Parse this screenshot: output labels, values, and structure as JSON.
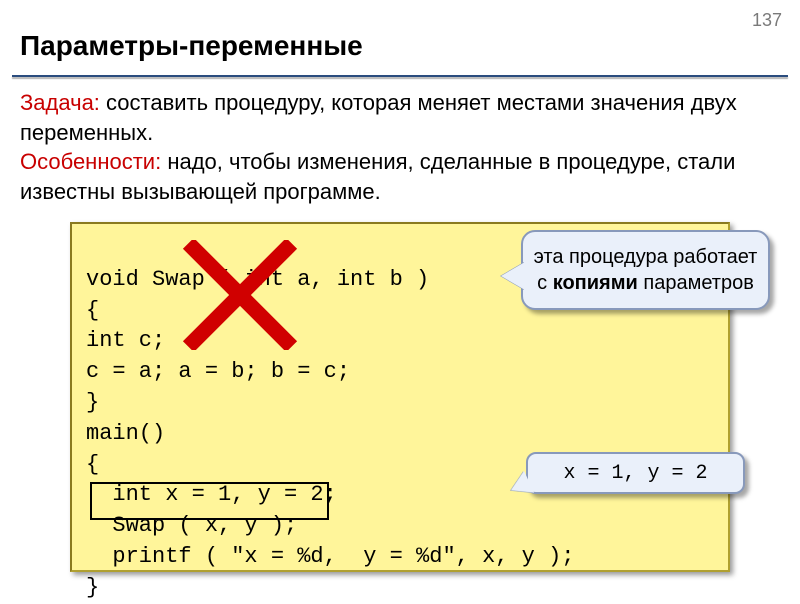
{
  "page_number": "137",
  "title": "Параметры-переменные",
  "task_label": "Задача:",
  "task_text": " составить процедуру, которая меняет местами значения двух переменных.",
  "features_label": "Особенности:",
  "features_text": " надо, чтобы изменения, сделанные в процедуре, стали известны вызывающей программе.",
  "code": {
    "l1": "void Swap ( int a, int b )",
    "l2": "{",
    "l3": "int c;",
    "l4": "c = a; a = b; b = c;",
    "l5": "}",
    "l6": "main()",
    "l7": "{",
    "l8": "  int x = 1, y = 2;",
    "l9": "  Swap ( x, y );",
    "l10": "  printf ( \"x = %d,  y = %d\", x, y );",
    "l11": "}"
  },
  "callout": {
    "line1": "эта процедура работает с",
    "bold": "копиями",
    "line3": "параметров"
  },
  "result": "x = 1,  y = 2"
}
